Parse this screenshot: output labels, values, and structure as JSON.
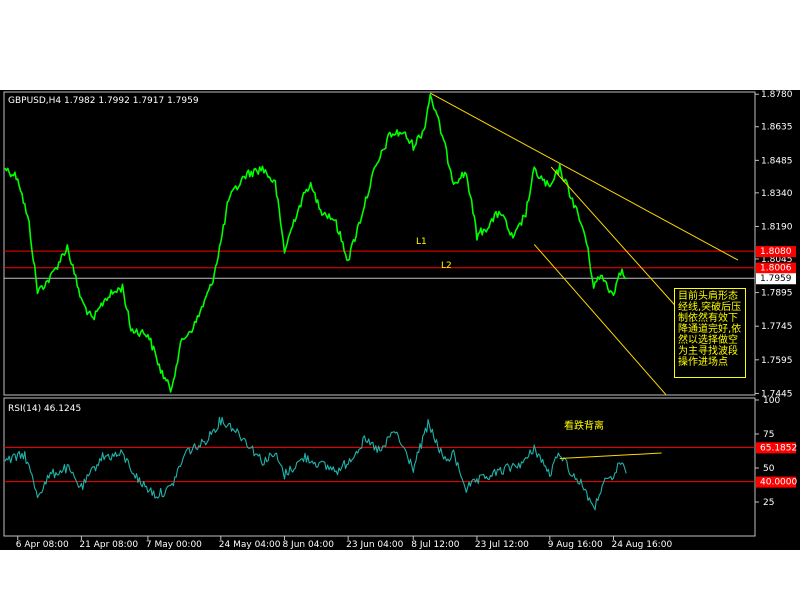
{
  "chart_data": [
    {
      "type": "line",
      "panel": "price",
      "header": "GBPUSD,H4  1.7982 1.7992 1.7917 1.7959",
      "symbol": "GBPUSD,H4",
      "ohlc": {
        "open": 1.7982,
        "high": 1.7992,
        "low": 1.7917,
        "close": 1.7959
      },
      "ylim": [
        1.7438,
        1.879
      ],
      "y_ticks": [
        "1.8780",
        "1.8635",
        "1.8485",
        "1.8340",
        "1.8190",
        "1.8045",
        "1.7895",
        "1.7745",
        "1.7595",
        "1.7445"
      ],
      "current_price_label": "1.7959",
      "current_price": 1.7959,
      "horizontal_lines": [
        {
          "label": "1.8080",
          "value": 1.808,
          "color": "#ff0000"
        },
        {
          "label": "1.8006",
          "value": 1.8006,
          "color": "#ff0000"
        },
        {
          "value": 1.7959,
          "color": "#c0c0c0"
        }
      ],
      "line_labels": {
        "l1": "L1",
        "l2": "L2"
      },
      "series_color": "#00ff00",
      "trendline_color": "#ffd700",
      "note_text": "目前头肩形态经线,突破后压制依然有效下降通道完好,依然以选择做空为主寻找波段操作进场点",
      "anchors": [
        {
          "date": "2014-04-03 08:00",
          "y": 1.845
        },
        {
          "date": "2014-04-06 08:00",
          "y": 1.841
        },
        {
          "date": "2014-04-09 00:00",
          "y": 1.82
        },
        {
          "date": "2014-04-11 00:00",
          "y": 1.79
        },
        {
          "date": "2014-04-14 00:00",
          "y": 1.796
        },
        {
          "date": "2014-04-18 00:00",
          "y": 1.81
        },
        {
          "date": "2014-04-21 08:00",
          "y": 1.786
        },
        {
          "date": "2014-04-24 00:00",
          "y": 1.777
        },
        {
          "date": "2014-04-27 00:00",
          "y": 1.787
        },
        {
          "date": "2014-05-01 00:00",
          "y": 1.792
        },
        {
          "date": "2014-05-03 00:00",
          "y": 1.773
        },
        {
          "date": "2014-05-07 00:00",
          "y": 1.771
        },
        {
          "date": "2014-05-10 00:00",
          "y": 1.755
        },
        {
          "date": "2014-05-12 08:00",
          "y": 1.746
        },
        {
          "date": "2014-05-15 00:00",
          "y": 1.768
        },
        {
          "date": "2014-05-18 00:00",
          "y": 1.775
        },
        {
          "date": "2014-05-22 00:00",
          "y": 1.793
        },
        {
          "date": "2014-05-24 04:00",
          "y": 1.812
        },
        {
          "date": "2014-05-26 00:00",
          "y": 1.831
        },
        {
          "date": "2014-05-30 00:00",
          "y": 1.842
        },
        {
          "date": "2014-06-03 00:00",
          "y": 1.845
        },
        {
          "date": "2014-06-06 00:00",
          "y": 1.838
        },
        {
          "date": "2014-06-08 04:00",
          "y": 1.808
        },
        {
          "date": "2014-06-11 00:00",
          "y": 1.825
        },
        {
          "date": "2014-06-14 00:00",
          "y": 1.838
        },
        {
          "date": "2014-06-17 00:00",
          "y": 1.826
        },
        {
          "date": "2014-06-20 00:00",
          "y": 1.822
        },
        {
          "date": "2014-06-23 04:00",
          "y": 1.804
        },
        {
          "date": "2014-06-26 00:00",
          "y": 1.822
        },
        {
          "date": "2014-06-29 00:00",
          "y": 1.842
        },
        {
          "date": "2014-07-03 00:00",
          "y": 1.86
        },
        {
          "date": "2014-07-06 00:00",
          "y": 1.861
        },
        {
          "date": "2014-07-08 12:00",
          "y": 1.855
        },
        {
          "date": "2014-07-11 00:00",
          "y": 1.862
        },
        {
          "date": "2014-07-12 12:00",
          "y": 1.878
        },
        {
          "date": "2014-07-15 00:00",
          "y": 1.862
        },
        {
          "date": "2014-07-18 00:00",
          "y": 1.839
        },
        {
          "date": "2014-07-21 00:00",
          "y": 1.843
        },
        {
          "date": "2014-07-23 12:00",
          "y": 1.815
        },
        {
          "date": "2014-07-26 00:00",
          "y": 1.819
        },
        {
          "date": "2014-07-29 00:00",
          "y": 1.826
        },
        {
          "date": "2014-08-01 00:00",
          "y": 1.813
        },
        {
          "date": "2014-08-04 00:00",
          "y": 1.825
        },
        {
          "date": "2014-08-06 00:00",
          "y": 1.844
        },
        {
          "date": "2014-08-09 16:00",
          "y": 1.836
        },
        {
          "date": "2014-08-12 00:00",
          "y": 1.845
        },
        {
          "date": "2014-08-15 00:00",
          "y": 1.831
        },
        {
          "date": "2014-08-18 00:00",
          "y": 1.815
        },
        {
          "date": "2014-08-20 00:00",
          "y": 1.793
        },
        {
          "date": "2014-08-22 00:00",
          "y": 1.797
        },
        {
          "date": "2014-08-24 16:00",
          "y": 1.788
        },
        {
          "date": "2014-08-26 00:00",
          "y": 1.8
        },
        {
          "date": "2014-08-27 16:00",
          "y": 1.7959
        }
      ],
      "trendlines": [
        {
          "start": {
            "date": "2014-07-12 12:00",
            "y": 1.8785
          },
          "end": {
            "date": "2014-09-23 00:00",
            "y": 1.804
          }
        },
        {
          "start": {
            "date": "2014-08-10 00:00",
            "y": 1.8455
          },
          "end": {
            "date": "2014-09-09 00:00",
            "y": 1.782
          }
        },
        {
          "start": {
            "date": "2014-08-06 00:00",
            "y": 1.811
          },
          "end": {
            "date": "2014-09-06 00:00",
            "y": 1.744
          }
        }
      ]
    },
    {
      "type": "line",
      "panel": "indicator",
      "header": "RSI(14)  46.1245",
      "name": "RSI(14)",
      "value": 46.1245,
      "ylim": [
        0,
        100
      ],
      "y_ticks": [
        "100",
        "75",
        "50",
        "25"
      ],
      "levels": [
        {
          "label": "65.1852",
          "value": 65.1852,
          "color": "#ff0000"
        },
        {
          "label": "40.0000",
          "value": 40.0,
          "color": "#ff0000"
        }
      ],
      "series_color": "#20b2aa",
      "annotation": "看跌背离",
      "anchors": [
        {
          "date": "2014-04-03 08:00",
          "y": 55
        },
        {
          "date": "2014-04-08 00:00",
          "y": 60
        },
        {
          "date": "2014-04-11 00:00",
          "y": 30
        },
        {
          "date": "2014-04-14 00:00",
          "y": 45
        },
        {
          "date": "2014-04-18 00:00",
          "y": 50
        },
        {
          "date": "2014-04-21 08:00",
          "y": 35
        },
        {
          "date": "2014-04-26 00:00",
          "y": 58
        },
        {
          "date": "2014-05-01 00:00",
          "y": 60
        },
        {
          "date": "2014-05-05 00:00",
          "y": 40
        },
        {
          "date": "2014-05-09 00:00",
          "y": 30
        },
        {
          "date": "2014-05-12 08:00",
          "y": 35
        },
        {
          "date": "2014-05-16 00:00",
          "y": 62
        },
        {
          "date": "2014-05-20 00:00",
          "y": 68
        },
        {
          "date": "2014-05-24 04:00",
          "y": 85
        },
        {
          "date": "2014-05-27 00:00",
          "y": 80
        },
        {
          "date": "2014-05-30 00:00",
          "y": 70
        },
        {
          "date": "2014-06-03 00:00",
          "y": 55
        },
        {
          "date": "2014-06-06 00:00",
          "y": 60
        },
        {
          "date": "2014-06-08 04:00",
          "y": 45
        },
        {
          "date": "2014-06-13 00:00",
          "y": 58
        },
        {
          "date": "2014-06-17 00:00",
          "y": 52
        },
        {
          "date": "2014-06-21 00:00",
          "y": 48
        },
        {
          "date": "2014-06-23 04:00",
          "y": 55
        },
        {
          "date": "2014-06-27 00:00",
          "y": 70
        },
        {
          "date": "2014-07-01 00:00",
          "y": 62
        },
        {
          "date": "2014-07-04 00:00",
          "y": 78
        },
        {
          "date": "2014-07-08 12:00",
          "y": 50
        },
        {
          "date": "2014-07-12 00:00",
          "y": 82
        },
        {
          "date": "2014-07-16 00:00",
          "y": 55
        },
        {
          "date": "2014-07-18 00:00",
          "y": 60
        },
        {
          "date": "2014-07-21 00:00",
          "y": 35
        },
        {
          "date": "2014-07-23 12:00",
          "y": 40
        },
        {
          "date": "2014-07-27 00:00",
          "y": 45
        },
        {
          "date": "2014-07-31 00:00",
          "y": 50
        },
        {
          "date": "2014-08-04 00:00",
          "y": 55
        },
        {
          "date": "2014-08-06 00:00",
          "y": 65
        },
        {
          "date": "2014-08-09 16:00",
          "y": 45
        },
        {
          "date": "2014-08-12 00:00",
          "y": 62
        },
        {
          "date": "2014-08-15 00:00",
          "y": 45
        },
        {
          "date": "2014-08-18 00:00",
          "y": 35
        },
        {
          "date": "2014-08-20 00:00",
          "y": 18
        },
        {
          "date": "2014-08-22 00:00",
          "y": 38
        },
        {
          "date": "2014-08-24 16:00",
          "y": 42
        },
        {
          "date": "2014-08-26 00:00",
          "y": 55
        },
        {
          "date": "2014-08-27 16:00",
          "y": 46.1
        }
      ],
      "trendlines": [
        {
          "start": {
            "date": "2014-08-12 00:00",
            "y": 57
          },
          "end": {
            "date": "2014-09-05 00:00",
            "y": 61
          }
        }
      ]
    }
  ],
  "x_axis": {
    "start": "2014-04-03 08:00",
    "end": "2014-09-27 00:00",
    "ticks": [
      {
        "label": "6 Apr 08:00",
        "date": "2014-04-06 08:00"
      },
      {
        "label": "21 Apr 08:00",
        "date": "2014-04-21 08:00"
      },
      {
        "label": "7 May 00:00",
        "date": "2014-05-07 00:00"
      },
      {
        "label": "24 May 04:00",
        "date": "2014-05-24 04:00"
      },
      {
        "label": "8 Jun 04:00",
        "date": "2014-06-08 04:00"
      },
      {
        "label": "23 Jun 04:00",
        "date": "2014-06-23 04:00"
      },
      {
        "label": "8 Jul 12:00",
        "date": "2014-07-08 12:00"
      },
      {
        "label": "23 Jul 12:00",
        "date": "2014-07-23 12:00"
      },
      {
        "label": "9 Aug 16:00",
        "date": "2014-08-09 16:00"
      },
      {
        "label": "24 Aug 16:00",
        "date": "2014-08-24 16:00"
      }
    ]
  }
}
